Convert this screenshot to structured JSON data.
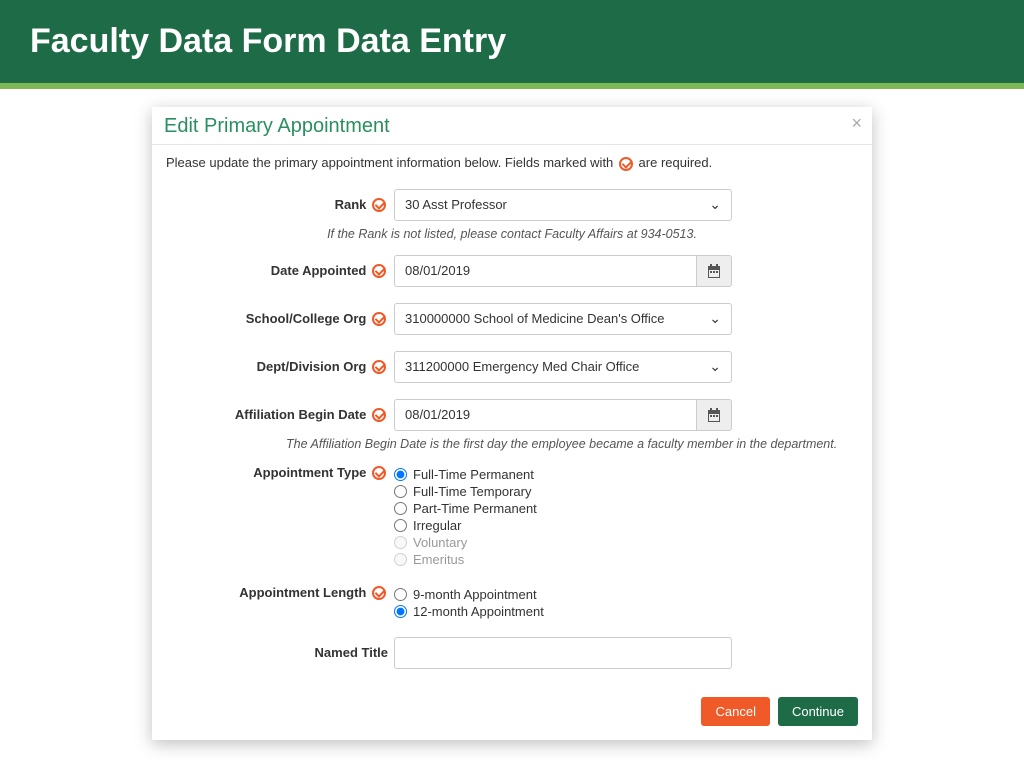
{
  "header": {
    "title": "Faculty Data Form Data Entry"
  },
  "modal": {
    "title": "Edit Primary Appointment",
    "instruction_prefix": "Please update the primary appointment information below. Fields marked with",
    "instruction_suffix": "are required.",
    "fields": {
      "rank": {
        "label": "Rank",
        "value": "30 Asst Professor",
        "helper": "If the Rank is not listed, please contact Faculty Affairs at 934-0513."
      },
      "date_appointed": {
        "label": "Date Appointed",
        "value": "08/01/2019"
      },
      "school_org": {
        "label": "School/College Org",
        "value": "310000000 School of Medicine Dean's Office"
      },
      "dept_org": {
        "label": "Dept/Division Org",
        "value": "311200000 Emergency Med Chair Office"
      },
      "affiliation_date": {
        "label": "Affiliation Begin Date",
        "value": "08/01/2019",
        "helper": "The Affiliation Begin Date is the first day the employee became a faculty member in the department."
      },
      "appointment_type": {
        "label": "Appointment Type",
        "options": [
          {
            "label": "Full-Time Permanent",
            "selected": true,
            "disabled": false
          },
          {
            "label": "Full-Time Temporary",
            "selected": false,
            "disabled": false
          },
          {
            "label": "Part-Time Permanent",
            "selected": false,
            "disabled": false
          },
          {
            "label": "Irregular",
            "selected": false,
            "disabled": false
          },
          {
            "label": "Voluntary",
            "selected": false,
            "disabled": true
          },
          {
            "label": "Emeritus",
            "selected": false,
            "disabled": true
          }
        ]
      },
      "appointment_length": {
        "label": "Appointment Length",
        "options": [
          {
            "label": "9-month Appointment",
            "selected": false
          },
          {
            "label": "12-month Appointment",
            "selected": true
          }
        ]
      },
      "named_title": {
        "label": "Named Title",
        "value": ""
      }
    },
    "buttons": {
      "cancel": "Cancel",
      "continue": "Continue"
    }
  }
}
